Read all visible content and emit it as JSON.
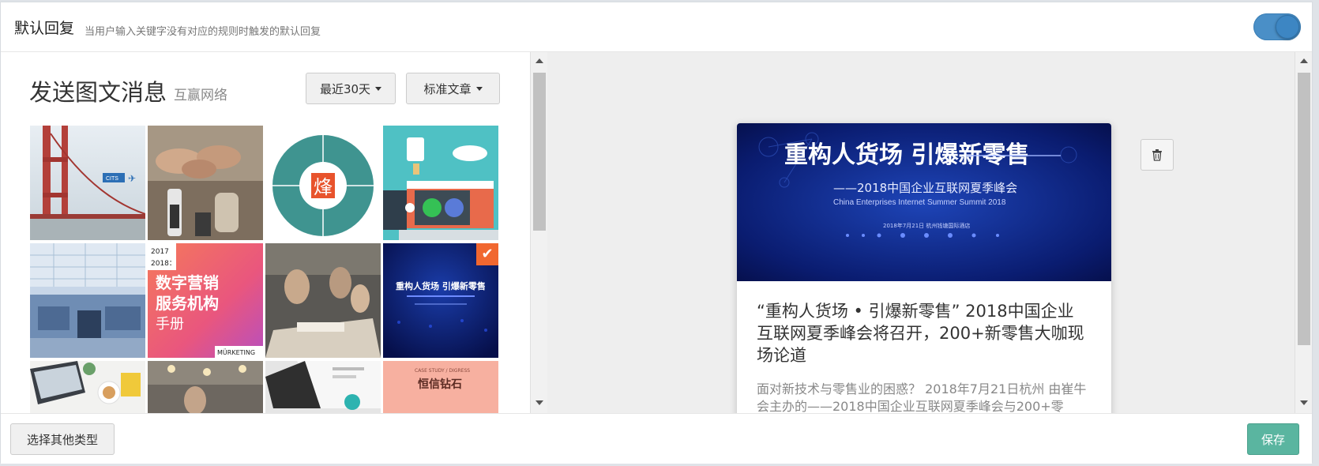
{
  "header": {
    "title": "默认回复",
    "subtitle": "当用户输入关键字没有对应的规则时触发的默认回复",
    "toggle_on": true
  },
  "left_panel": {
    "heading": "发送图文消息",
    "heading_sub": "互赢网络",
    "date_filter": "最近30天",
    "type_filter": "标准文章",
    "tiles": [
      {
        "name": "golden-gate-bridge",
        "text": "CITS"
      },
      {
        "name": "fist-bump-team",
        "text": ""
      },
      {
        "name": "feng-logo",
        "text": "烽"
      },
      {
        "name": "wechat-store-illustration",
        "text": ""
      },
      {
        "name": "office-interior",
        "text": ""
      },
      {
        "name": "digital-marketing-handbook",
        "text": "2017 — 2018：数字营销 服务机构 手册 MARKETING"
      },
      {
        "name": "team-meeting-table",
        "text": ""
      },
      {
        "name": "summit-cover-selected",
        "text": "重构人货场 引爆新零售",
        "selected": true
      },
      {
        "name": "laptop-desk",
        "text": ""
      },
      {
        "name": "office-lights",
        "text": ""
      },
      {
        "name": "tablet-chart",
        "text": ""
      },
      {
        "name": "hengxin-diamond",
        "text": "CASE STUDY / DIGRESS 恒信钻石"
      }
    ]
  },
  "preview": {
    "cover_title": "重构人货场 引爆新零售",
    "cover_subtitle": "——2018中国企业互联网夏季峰会",
    "cover_en": "China Enterprises Internet Summer Summit 2018",
    "cover_date": "2018年7月21日  杭州钱塘国际酒店",
    "title": "“重构人货场 • 引爆新零售” 2018中国企业互联网夏季峰会将召开，200+新零售大咖现场论道",
    "desc": "面对新技术与零售业的困惑？ 2018年7月21日杭州 由崔牛会主办的——2018中国企业互联网夏季峰会与200+零"
  },
  "footer": {
    "other_type_label": "选择其他类型",
    "save_label": "保存"
  },
  "colors": {
    "accent_blue": "#4a8fc7",
    "save_green": "#5ab5a0",
    "check_orange": "#f1672f"
  }
}
